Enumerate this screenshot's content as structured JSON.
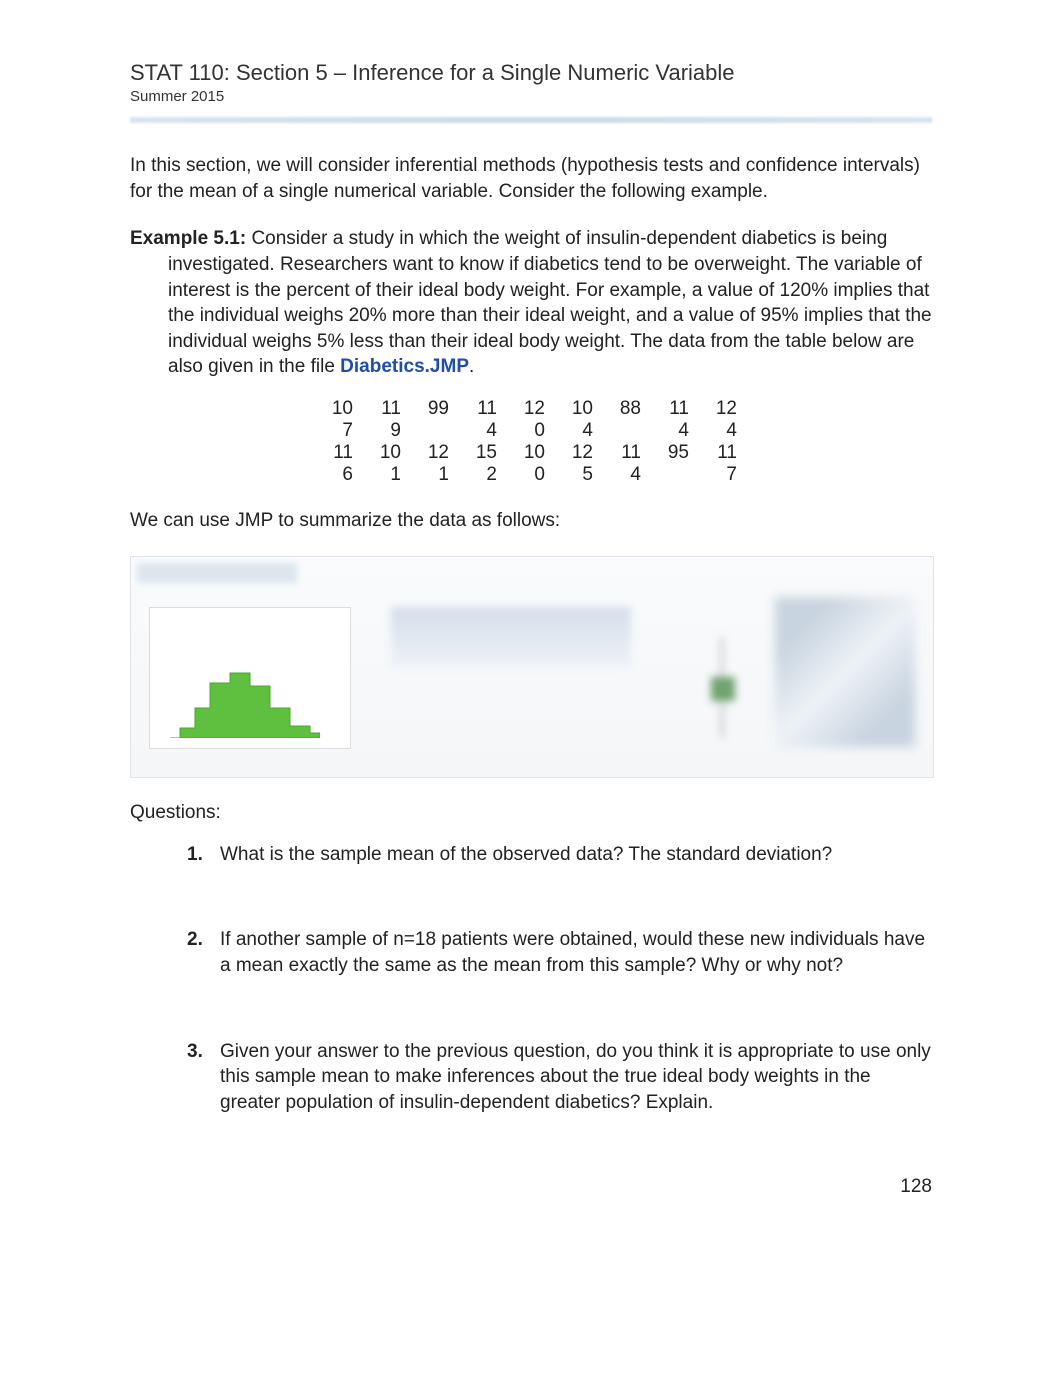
{
  "header": {
    "title": "STAT 110:  Section 5 – Inference for a Single Numeric Variable",
    "subtitle": "Summer 2015"
  },
  "intro": "In this section, we will consider inferential methods (hypothesis tests and confidence intervals) for the mean of a single numerical variable.  Consider the following example.",
  "example": {
    "label": "Example 5.1:",
    "body_pre": "  Consider a study in which the weight of insulin-dependent diabetics is being investigated.  Researchers want to know if diabetics tend to be overweight.  The variable of interest is the percent of their ideal body weight.  For example, a value of 120% implies that the individual weighs 20% more than their ideal weight, and a value of 95% implies that the individual weighs 5% less than their ideal body weight.  The data from the table below are also given in the file ",
    "file_link": "Diabetics.JMP",
    "body_post": "."
  },
  "data_rows": [
    [
      "10",
      "11",
      "99",
      "11",
      "12",
      "10",
      "88",
      "11",
      "12"
    ],
    [
      "7",
      "9",
      "",
      "4",
      "0",
      "4",
      "",
      "4",
      "4"
    ],
    [
      "11",
      "10",
      "12",
      "15",
      "10",
      "12",
      "11",
      "95",
      "11"
    ],
    [
      "6",
      "1",
      "1",
      "2",
      "0",
      "5",
      "4",
      "",
      "7"
    ]
  ],
  "jmp_line": "We can use JMP to summarize the data as follows:",
  "questions_label": "Questions:",
  "questions": [
    {
      "num": "1.",
      "text": "What is the sample mean of the observed data?  The standard deviation?"
    },
    {
      "num": "2.",
      "text": "If another sample of n=18 patients were obtained, would these new individuals have a mean exactly the same as the mean from this sample?  Why or why not?"
    },
    {
      "num": "3.",
      "text": "Given your answer to the previous question, do you think it is appropriate to use only this sample mean to make inferences about the true ideal body weights in the greater population of insulin-dependent diabetics?  Explain."
    }
  ],
  "page_number": "128"
}
